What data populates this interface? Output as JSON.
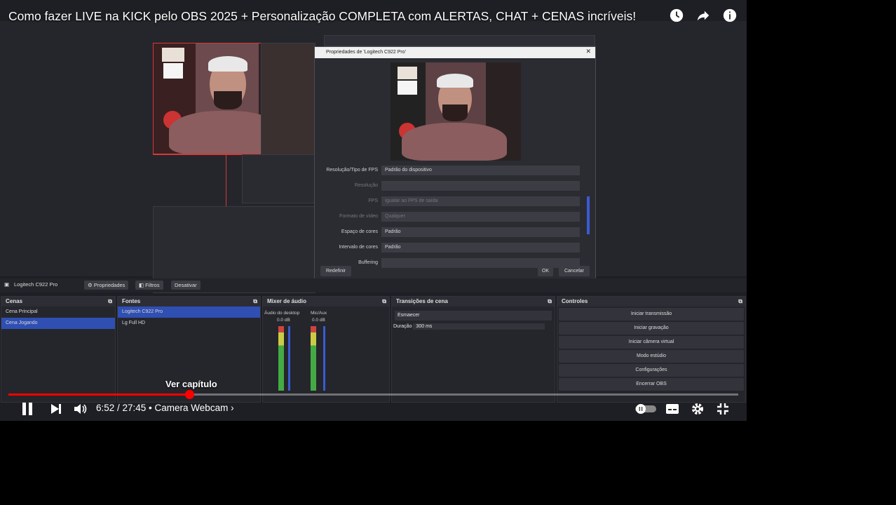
{
  "video": {
    "title": "Como fazer LIVE na KICK pelo OBS 2025 + Personalização COMPLETA com ALERTAS, CHAT + CENAS incríveis!",
    "top_icons": [
      "clock-icon",
      "share-icon",
      "info-icon"
    ]
  },
  "dialog": {
    "title": "Propriedades de 'Logitech C922 Pro'",
    "rows": [
      {
        "label": "Resolução/Tipo de FPS",
        "value": "Padrão do dispositivo",
        "dim": false
      },
      {
        "label": "Resolução",
        "value": "",
        "dim": true
      },
      {
        "label": "FPS",
        "value": "Igualar ao FPS de saída",
        "dim": true
      },
      {
        "label": "Formato de vídeo",
        "value": "Qualquer",
        "dim": true
      },
      {
        "label": "Espaço de cores",
        "value": "Padrão",
        "dim": false
      },
      {
        "label": "Intervalo de cores",
        "value": "Padrão",
        "dim": false
      },
      {
        "label": "Buffering",
        "value": "",
        "dim": false
      }
    ],
    "reset_label": "Redefinir",
    "ok_label": "OK",
    "cancel_label": "Cancelar"
  },
  "source_toolbar": {
    "source_name": "Logitech C922 Pro",
    "properties_label": "Propriedades",
    "filters_label": "Filtros",
    "deactivate_label": "Desativar"
  },
  "docks": {
    "scenes": {
      "title": "Cenas",
      "items": [
        "Cena Principal",
        "Cena Jogando"
      ],
      "selected": 1
    },
    "sources": {
      "title": "Fontes",
      "items": [
        "Logitech C922 Pro",
        "Lg Full HD"
      ],
      "selected": 0
    },
    "mixer": {
      "title": "Mixer de áudio",
      "channels": [
        {
          "name": "Áudio do desktop",
          "db": "0.0 dB"
        },
        {
          "name": "Mic/Aux",
          "db": "0.0 dB"
        }
      ]
    },
    "transitions": {
      "title": "Transições de cena",
      "transition": "Esmaecer",
      "duration_label": "Duração",
      "duration": "300 ms"
    },
    "controls": {
      "title": "Controles",
      "buttons": [
        "Iniciar transmissão",
        "Iniciar gravação",
        "Iniciar câmera virtual",
        "Modo estúdio",
        "Configurações",
        "Encerrar OBS"
      ]
    }
  },
  "player": {
    "chapter_tooltip": "Ver capítulo",
    "time": "6:52 / 27:45 • Camera Webcam ›",
    "progress_fraction": 0.248,
    "accent": "#ff0000"
  }
}
